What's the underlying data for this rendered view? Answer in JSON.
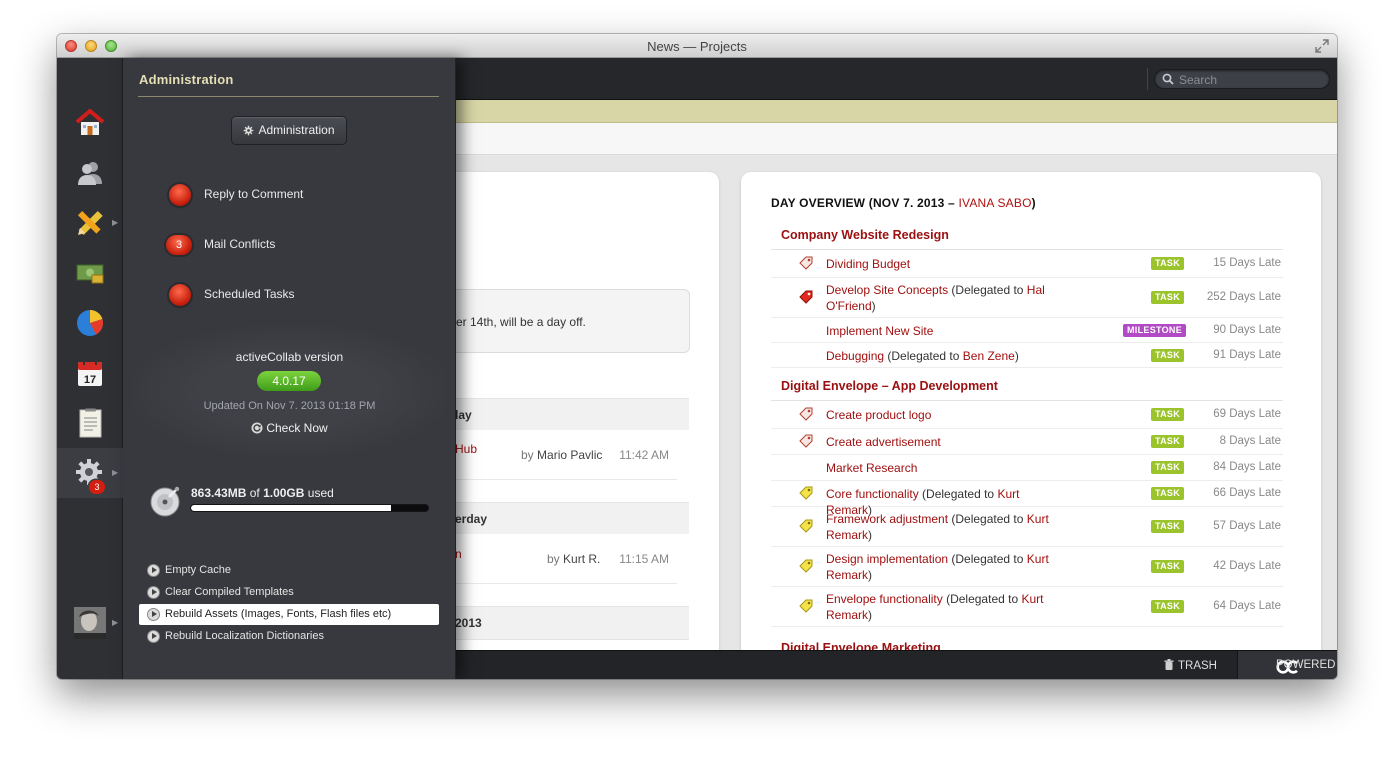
{
  "window": {
    "title": "News — Projects"
  },
  "search": {
    "placeholder": "Search"
  },
  "admin": {
    "title": "Administration",
    "button_label": "Administration",
    "actions": [
      {
        "label": "Reply to Comment",
        "count": ""
      },
      {
        "label": "Mail Conflicts",
        "count": "3"
      },
      {
        "label": "Scheduled Tasks",
        "count": ""
      }
    ],
    "version_label": "activeCollab version",
    "version": "4.0.17",
    "updated": "Updated On Nov 7. 2013 01:18 PM",
    "check_now": "Check Now",
    "disk": {
      "used": "863.43MB",
      "of": "of",
      "total": "1.00GB",
      "used_label": "used",
      "fraction": 0.843
    },
    "links": [
      "Empty Cache",
      "Clear Compiled Templates",
      "Rebuild Assets (Images, Fonts, Flash files etc)",
      "Rebuild Localization Dictionaries"
    ]
  },
  "nav": {
    "items": [
      "home-icon",
      "people-icon",
      "pencil-ruler-icon",
      "money-icon",
      "pie-chart-icon",
      "calendar-icon",
      "notebook-icon",
      "settings-gear-icon",
      "user-avatar"
    ],
    "calendar_day": "17",
    "settings_badge": "3"
  },
  "news": {
    "notice": "er 14th, will be a day off.",
    "groups": [
      {
        "heading": "lay",
        "items": [
          {
            "link": "Hub",
            "by_prefix": "by",
            "author": "Mario Pavlic",
            "time": "11:42 AM"
          }
        ]
      },
      {
        "heading": "erday",
        "items": [
          {
            "link": "n",
            "by_prefix": "by",
            "author": "Kurt R.",
            "time": "11:15 AM"
          }
        ]
      },
      {
        "heading": "2013",
        "items": []
      }
    ]
  },
  "overview": {
    "title_prefix": "DAY OVERVIEW (NOV 7. 2013 – ",
    "user": "IVANA SABO",
    "title_suffix": ")",
    "projects": [
      {
        "name": "Company Website Redesign",
        "tasks": [
          {
            "link": "Dividing Budget",
            "suffix": "",
            "delegate": "",
            "end": "",
            "badge": "TASK",
            "late": "15 Days Late",
            "icon": "label-red"
          },
          {
            "link": "Develop Site Concepts",
            "suffix": " (Delegated to ",
            "delegate": "Hal O'Friend",
            "end": ")",
            "badge": "TASK",
            "late": "252 Days Late",
            "icon": "label-red-solid"
          },
          {
            "link": "Implement New Site",
            "suffix": "",
            "delegate": "",
            "end": "",
            "badge": "MILESTONE",
            "late": "90 Days Late",
            "icon": ""
          },
          {
            "link": "Debugging",
            "suffix": " (Delegated to ",
            "delegate": "Ben Zene",
            "end": ")",
            "badge": "TASK",
            "late": "91 Days Late",
            "icon": ""
          }
        ]
      },
      {
        "name": "Digital Envelope – App Development",
        "tasks": [
          {
            "link": "Create product logo",
            "suffix": "",
            "delegate": "",
            "end": "",
            "badge": "TASK",
            "late": "69 Days Late",
            "icon": "label-red"
          },
          {
            "link": "Create advertisement",
            "suffix": "",
            "delegate": "",
            "end": "",
            "badge": "TASK",
            "late": "8 Days Late",
            "icon": "label-red"
          },
          {
            "link": "Market Research",
            "suffix": "",
            "delegate": "",
            "end": "",
            "badge": "TASK",
            "late": "84 Days Late",
            "icon": ""
          },
          {
            "link": "Core functionality",
            "suffix": " (Delegated to ",
            "delegate": "Kurt Remark",
            "end": ")",
            "badge": "TASK",
            "late": "66 Days Late",
            "icon": "label-yellow"
          },
          {
            "link": "Framework adjustment",
            "suffix": " (Delegated to ",
            "delegate": "Kurt Remark",
            "end": ")",
            "badge": "TASK",
            "late": "57 Days Late",
            "icon": "label-yellow"
          },
          {
            "link": "Design implementation",
            "suffix": " (Delegated to ",
            "delegate": "Kurt Remark",
            "end": ")",
            "badge": "TASK",
            "late": "42 Days Late",
            "icon": "label-yellow"
          },
          {
            "link": "Envelope functionality",
            "suffix": " (Delegated to ",
            "delegate": "Kurt Remark",
            "end": ")",
            "badge": "TASK",
            "late": "64 Days Late",
            "icon": "label-yellow"
          }
        ]
      },
      {
        "name": "Digital Envelope Marketing",
        "tasks": []
      }
    ]
  },
  "statusbar": {
    "trash": "TRASH",
    "powered": "POWERED"
  },
  "colors": {
    "accent_red": "#a01010",
    "task_green": "#9bc42c",
    "milestone_purple": "#b14ac4",
    "version_green": "#4fae24"
  }
}
